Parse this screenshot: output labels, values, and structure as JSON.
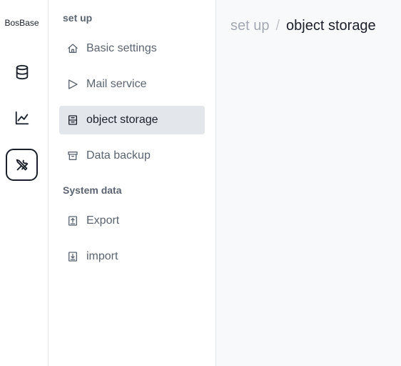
{
  "app": {
    "brand": "BosBase"
  },
  "rail": {
    "items": [
      {
        "icon": "database-icon",
        "active": false
      },
      {
        "icon": "chart-line-icon",
        "active": false
      },
      {
        "icon": "tools-icon",
        "active": true
      }
    ]
  },
  "sidebar": {
    "sections": [
      {
        "title": "set up"
      },
      {
        "title": "System data"
      }
    ],
    "items": [
      {
        "label": "Basic settings",
        "icon": "home-icon"
      },
      {
        "label": "Mail service",
        "icon": "send-icon"
      },
      {
        "label": "object storage",
        "icon": "hard-drive-icon",
        "active": true
      },
      {
        "label": "Data backup",
        "icon": "archive-icon"
      },
      {
        "label": "Export",
        "icon": "export-icon"
      },
      {
        "label": "import",
        "icon": "import-icon"
      }
    ]
  },
  "breadcrumb": {
    "parent": "set up",
    "separator": "/",
    "current": "object storage"
  },
  "colors": {
    "active_item_bg": "#e3e7eb",
    "muted_text": "#5b6470",
    "main_bg": "#f8f9fa"
  }
}
